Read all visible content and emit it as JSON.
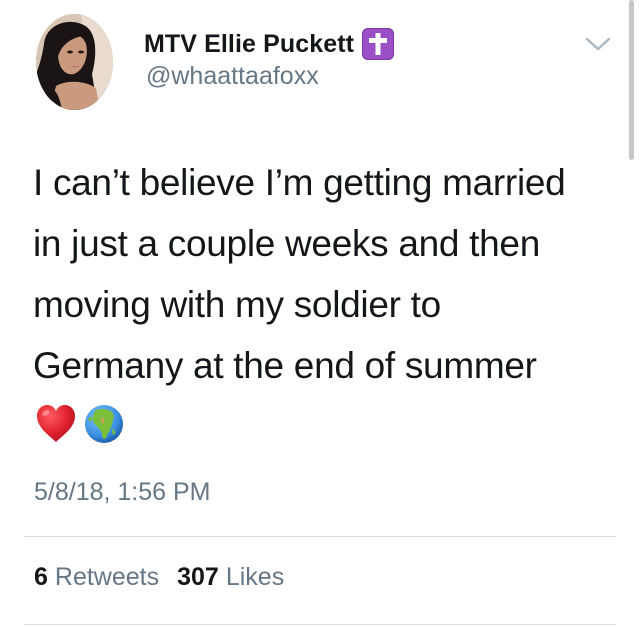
{
  "user": {
    "display_name": "MTV Ellie Puckett",
    "handle": "@whaattaafoxx",
    "badge_icon": "latin-cross-icon",
    "badge_color": "#9b4fc6"
  },
  "tweet": {
    "lines": [
      "I can’t believe I’m getting married",
      "in just a couple weeks and then",
      "moving with my soldier to",
      "Germany at the end of summer"
    ],
    "emojis": [
      "red-heart-icon",
      "globe-africa-icon"
    ],
    "timestamp": "5/8/18, 1:56 PM"
  },
  "stats": {
    "retweets_count": "6",
    "retweets_label": "Retweets",
    "likes_count": "307",
    "likes_label": "Likes"
  },
  "colors": {
    "text": "#14171a",
    "secondary_text": "#657786",
    "divider": "#d6dbdf",
    "heart": "#e0222f",
    "globe_ocean": "#3b8fe0",
    "globe_land": "#7bbf3a"
  }
}
